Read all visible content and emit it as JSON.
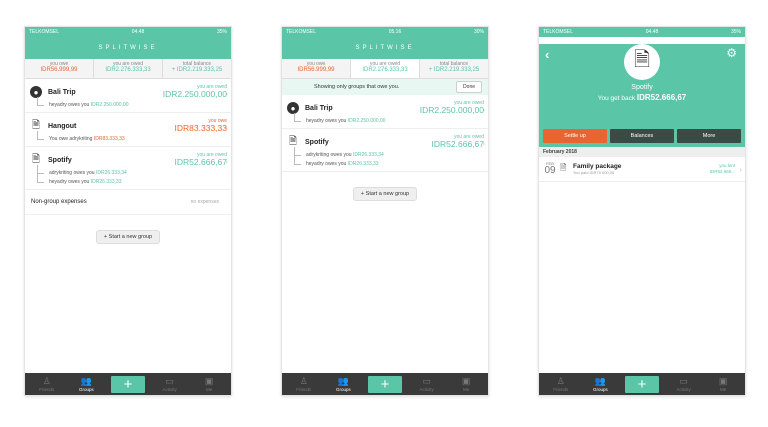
{
  "status": {
    "carrier": "TELKOMSEL",
    "time1": "04.48",
    "time2": "05.16",
    "time3": "04.48",
    "batt1": "35%",
    "batt2": "30%",
    "batt3": "35%"
  },
  "header": {
    "title": "SPLITWISE"
  },
  "summary": [
    {
      "label": "you owe",
      "amount": "IDR56.999,99"
    },
    {
      "label": "you are owed",
      "amount": "IDR2.276.333,33"
    },
    {
      "label": "total balance",
      "amount": "+ IDR2.219.333,25"
    }
  ],
  "groups_all": [
    {
      "name": "Bali Trip",
      "icon": "globe-icon",
      "balance_label": "you are owed",
      "balance": "IDR2.250.000,00",
      "tone": "teal",
      "sub": [
        {
          "text": "heyadry owes you ",
          "amount": "IDR2.250.000,00",
          "tone": "teal"
        }
      ]
    },
    {
      "name": "Hangout",
      "icon": "document-icon",
      "balance_label": "you owe",
      "balance": "IDR83.333,33",
      "tone": "orange",
      "sub": [
        {
          "text": "You owe adrykriting ",
          "amount": "IDR83.333,33",
          "tone": "orange"
        }
      ]
    },
    {
      "name": "Spotify",
      "icon": "document-icon",
      "balance_label": "you are owed",
      "balance": "IDR52.666,67",
      "tone": "teal",
      "sub": [
        {
          "text": "adrykriting owes you ",
          "amount": "IDR26.333,34",
          "tone": "teal"
        },
        {
          "text": "heyadry owes you ",
          "amount": "IDR26.333,33",
          "tone": "teal"
        }
      ]
    }
  ],
  "non_group": {
    "label": "Non-group expenses",
    "value": "no expenses"
  },
  "new_group": "+ Start a new group",
  "filter": {
    "notice": "Showing only groups that owe you.",
    "done": "Done"
  },
  "groups_owed": [
    {
      "name": "Bali Trip",
      "icon": "globe-icon",
      "balance_label": "you are owed",
      "balance": "IDR2.250.000,00",
      "tone": "teal",
      "sub": [
        {
          "text": "heyadry owes you ",
          "amount": "IDR2.250.000,00",
          "tone": "teal"
        }
      ]
    },
    {
      "name": "Spotify",
      "icon": "document-icon",
      "balance_label": "you are owed",
      "balance": "IDR52.666,67",
      "tone": "teal",
      "sub": [
        {
          "text": "adrykriting owes you ",
          "amount": "IDR26.333,34",
          "tone": "teal"
        },
        {
          "text": "heyadry owes you ",
          "amount": "IDR26.333,33",
          "tone": "teal"
        }
      ]
    }
  ],
  "tabs": [
    {
      "label": "Friends",
      "icon": "person-icon",
      "glyph": "♙"
    },
    {
      "label": "Groups",
      "icon": "group-icon",
      "glyph": "👥",
      "active": true
    },
    {
      "label": "",
      "icon": "plus-icon",
      "glyph": "+",
      "plus": true
    },
    {
      "label": "Activity",
      "icon": "activity-icon",
      "glyph": "▭"
    },
    {
      "label": "Me",
      "icon": "me-icon",
      "glyph": "▣"
    }
  ],
  "detail": {
    "name": "Spotify",
    "summary_prefix": "You get back ",
    "summary_amount": "IDR52.666,67",
    "actions": [
      "Settle up",
      "Balances",
      "More"
    ],
    "month": "February 2018",
    "expense": {
      "mon": "FEB",
      "day": "09",
      "name": "Family package",
      "paid": "You paid IDR79.000,00",
      "label": "you lent",
      "amount": "IDR52.666..."
    }
  },
  "colors": {
    "accent": "#5bc5a7",
    "owe": "#e8652f",
    "tabbar": "#3a3a3a"
  }
}
